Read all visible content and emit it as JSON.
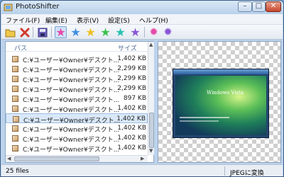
{
  "window": {
    "title": "PhotoShifter"
  },
  "menu": [
    "ファイル(F)",
    "編集(E)",
    "表示(V)",
    "設定(S)",
    "ヘルプ(H)"
  ],
  "list": {
    "headers": {
      "path": "パス",
      "size": "サイズ"
    },
    "rows": [
      {
        "path": "C:¥ユーザー¥Owner¥デスクト...",
        "size": "1,402 KB",
        "selected": false
      },
      {
        "path": "C:¥ユーザー¥Owner¥デスクト...",
        "size": "2,299 KB",
        "selected": false
      },
      {
        "path": "C:¥ユーザー¥Owner¥デスクト...",
        "size": "2,299 KB",
        "selected": false
      },
      {
        "path": "C:¥ユーザー¥Owner¥デスクト...",
        "size": "2,299 KB",
        "selected": false
      },
      {
        "path": "C:¥ユーザー¥Owner¥デスクト...",
        "size": "897 KB",
        "selected": false
      },
      {
        "path": "C:¥ユーザー¥Owner¥デスクト...",
        "size": "1,402 KB",
        "selected": false
      },
      {
        "path": "C:¥ユーザー¥Owner¥デスクト...",
        "size": "1,402 KB",
        "selected": true
      },
      {
        "path": "C:¥ユーザー¥Owner¥デスクト...",
        "size": "1,402 KB",
        "selected": false
      },
      {
        "path": "C:¥ユーザー¥Owner¥デスクト...",
        "size": "1,402 KB",
        "selected": false
      },
      {
        "path": "C:¥ユーザー¥Owner¥デスクト...",
        "size": "1,402 KB",
        "selected": false
      },
      {
        "path": "C:¥ユーザー¥Owner¥デスクト...",
        "size": "1,402 KB",
        "selected": false
      }
    ]
  },
  "preview": {
    "logo_text": "Windows Vista"
  },
  "status": {
    "file_count": "25 files",
    "action": "JPEGに変換"
  },
  "toolbar": {
    "icons": [
      "open-folder-icon",
      "delete-icon",
      "save-icon",
      "star-pink-icon",
      "star-blue-icon",
      "star-yellow-icon",
      "star-green-icon",
      "star-cyan-icon",
      "star-purple-icon",
      "gear-pink-icon",
      "gear-purple-icon"
    ],
    "colors": {
      "pink": "#e64aa8",
      "blue": "#3f8fe0",
      "yellow": "#f0c020",
      "green": "#3cc04a",
      "cyan": "#28c0b0",
      "purple": "#8a55d6",
      "red": "#d03a2e"
    }
  }
}
